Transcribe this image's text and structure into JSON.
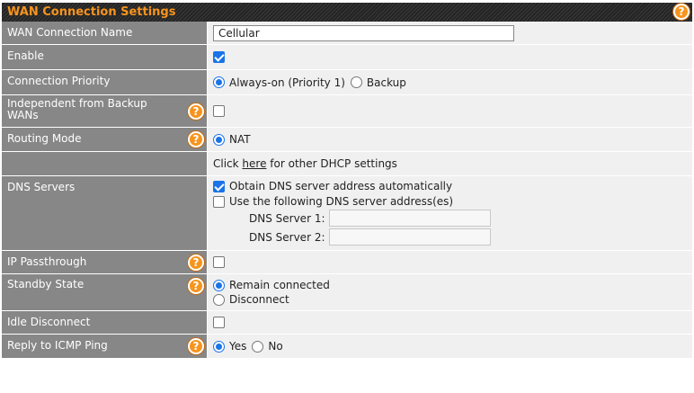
{
  "header": {
    "title": "WAN Connection Settings"
  },
  "rows": {
    "name": {
      "label": "WAN Connection Name",
      "value": "Cellular"
    },
    "enable": {
      "label": "Enable",
      "checked": true
    },
    "priority": {
      "label": "Connection Priority",
      "opt1": "Always-on (Priority 1)",
      "opt2": "Backup",
      "selected": "Always-on (Priority 1)"
    },
    "independent": {
      "label": "Independent from Backup WANs",
      "checked": false
    },
    "routing": {
      "label": "Routing Mode",
      "opt1": "NAT",
      "selected": "NAT"
    },
    "dhcp": {
      "prefix": "Click ",
      "link": "here",
      "suffix": " for other DHCP settings"
    },
    "dns": {
      "label": "DNS Servers",
      "auto_label": "Obtain DNS server address automatically",
      "auto_checked": true,
      "manual_label": "Use the following DNS server address(es)",
      "manual_checked": false,
      "server1_label": "DNS Server 1:",
      "server1_value": "",
      "server2_label": "DNS Server 2:",
      "server2_value": ""
    },
    "ip_passthrough": {
      "label": "IP Passthrough",
      "checked": false
    },
    "standby": {
      "label": "Standby State",
      "opt1": "Remain connected",
      "opt2": "Disconnect",
      "selected": "Remain connected"
    },
    "idle": {
      "label": "Idle Disconnect",
      "checked": false
    },
    "icmp": {
      "label": "Reply to ICMP Ping",
      "opt1": "Yes",
      "opt2": "No",
      "selected": "Yes"
    }
  },
  "help_glyph": "?",
  "icons": {
    "help": "help-icon"
  },
  "colors": {
    "accent": "#f7941d",
    "label_bg": "#878787",
    "value_bg": "#f0f0f0",
    "check": "#1a73e8"
  }
}
